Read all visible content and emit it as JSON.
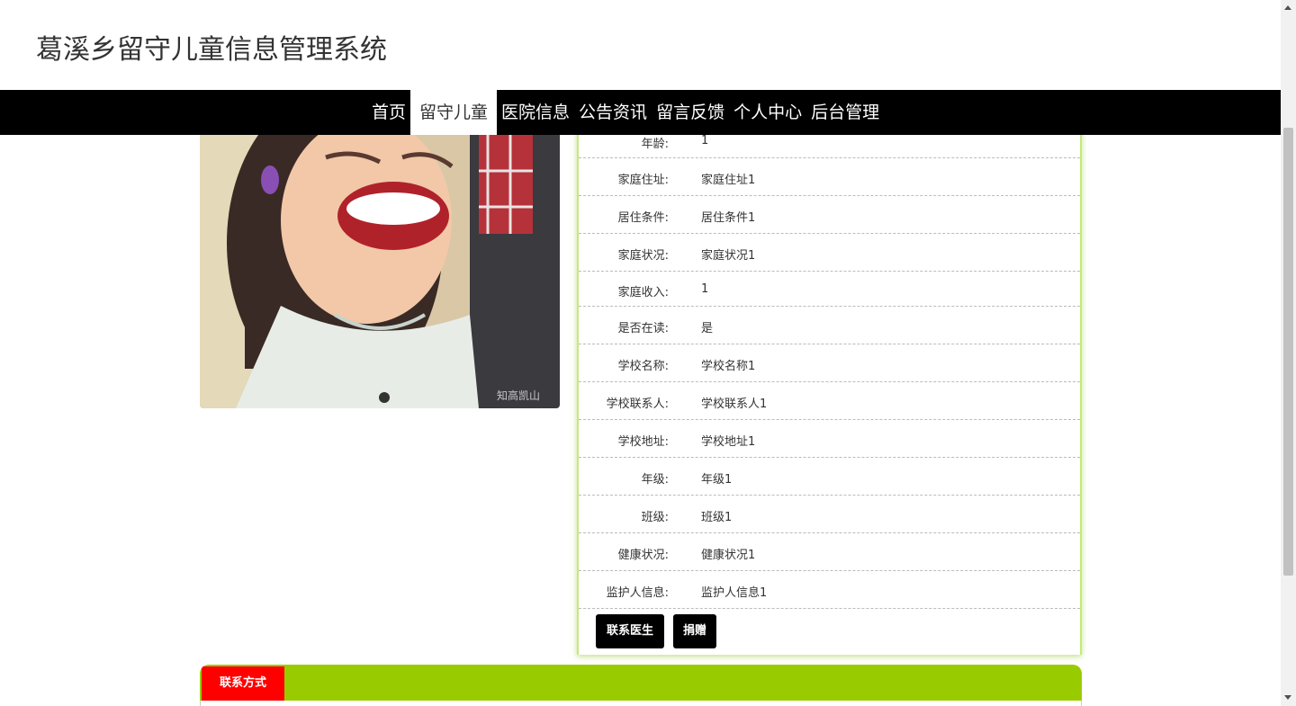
{
  "site": {
    "title": "葛溪乡留守儿童信息管理系统"
  },
  "nav": [
    {
      "label": "首页"
    },
    {
      "label": "留守儿童",
      "active": true
    },
    {
      "label": "医院信息"
    },
    {
      "label": "公告资讯"
    },
    {
      "label": "留言反馈"
    },
    {
      "label": "个人中心"
    },
    {
      "label": "后台管理"
    }
  ],
  "photo": {
    "watermark": "知高凯山"
  },
  "details": [
    {
      "label": "年龄:",
      "value": "1"
    },
    {
      "label": "家庭住址:",
      "value": "家庭住址1"
    },
    {
      "label": "居住条件:",
      "value": "居住条件1"
    },
    {
      "label": "家庭状况:",
      "value": "家庭状况1"
    },
    {
      "label": "家庭收入:",
      "value": "1"
    },
    {
      "label": "是否在读:",
      "value": "是"
    },
    {
      "label": "学校名称:",
      "value": "学校名称1"
    },
    {
      "label": "学校联系人:",
      "value": "学校联系人1"
    },
    {
      "label": "学校地址:",
      "value": "学校地址1"
    },
    {
      "label": "年级:",
      "value": "年级1"
    },
    {
      "label": "班级:",
      "value": "班级1"
    },
    {
      "label": "健康状况:",
      "value": "健康状况1"
    },
    {
      "label": "监护人信息:",
      "value": "监护人信息1"
    }
  ],
  "actions": {
    "contact_doctor": "联系医生",
    "donate": "捐赠"
  },
  "contact": {
    "tab_label": "联系方式"
  },
  "colors": {
    "accent_green": "#99cc00",
    "tab_red": "#ff0000",
    "nav_bg": "#000000"
  }
}
